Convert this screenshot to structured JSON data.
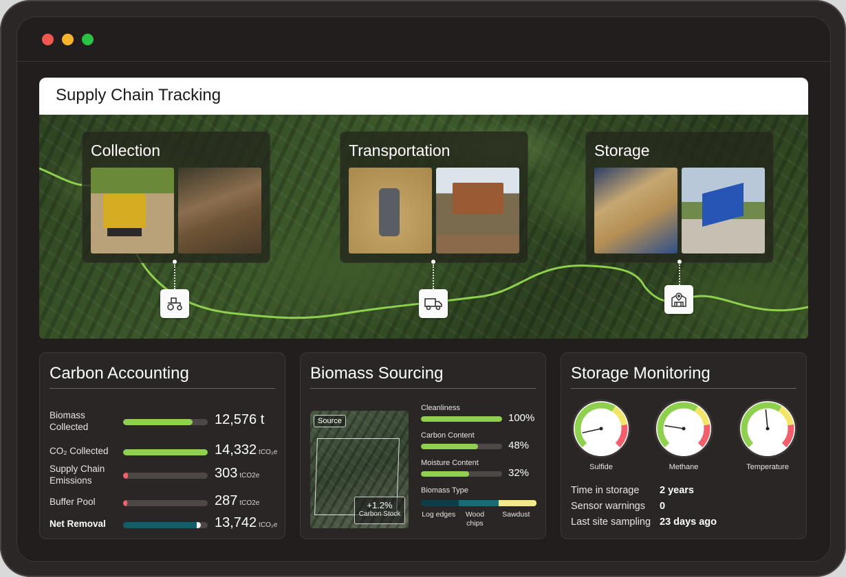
{
  "window": {
    "controls": [
      "close",
      "minimize",
      "maximize"
    ]
  },
  "supply_chain": {
    "title": "Supply Chain Tracking",
    "stages": [
      {
        "title": "Collection",
        "icon": "tractor-icon",
        "photos": [
          "wheel-loader-photo",
          "wood-logs-photo"
        ]
      },
      {
        "title": "Transportation",
        "icon": "truck-icon",
        "photos": [
          "moisture-meter-photo",
          "dump-truck-photo"
        ]
      },
      {
        "title": "Storage",
        "icon": "warehouse-location-icon",
        "photos": [
          "auger-conveyor-photo",
          "dump-trailer-photo"
        ]
      }
    ]
  },
  "carbon_accounting": {
    "title": "Carbon Accounting",
    "rows": [
      {
        "label": "Biomass Collected",
        "value": "12,576 t",
        "unit": "",
        "fill": 0.82,
        "color": "#8fd14f"
      },
      {
        "label": "CO₂ Collected",
        "value": "14,332",
        "unit": "tCO₂e",
        "fill": 1.0,
        "color": "#8fd14f"
      },
      {
        "label": "Supply Chain Emissions",
        "value": "303",
        "unit": "tCO2e",
        "fill": 0.06,
        "color": "#f25f6c"
      },
      {
        "label": "Buffer Pool",
        "value": "287",
        "unit": "tCO2e",
        "fill": 0.05,
        "color": "#f25f6c"
      },
      {
        "label": "Net Removal",
        "value": "13,742",
        "unit": "tCO₂e",
        "fill": 0.92,
        "color": "#145e6a",
        "bold": true
      }
    ]
  },
  "biomass_sourcing": {
    "title": "Biomass Sourcing",
    "source_tag": "Source",
    "carbon_stock_change": "+1.2%",
    "carbon_stock_label": "Carbon Stock",
    "qualities": [
      {
        "label": "Cleanliness",
        "value": "100%",
        "fill": 1.0
      },
      {
        "label": "Carbon Content",
        "value": "48%",
        "fill": 0.7
      },
      {
        "label": "Moisture Content",
        "value": "32%",
        "fill": 0.59
      }
    ],
    "biomass_type_label": "Biomass Type",
    "biomass_types": [
      {
        "label": "Log edges",
        "share": 0.33,
        "color": "#0f3d47"
      },
      {
        "label": "Wood chips",
        "share": 0.34,
        "color": "#1a6b78"
      },
      {
        "label": "Sawdust",
        "share": 0.33,
        "color": "#f3e98c"
      }
    ]
  },
  "storage_monitoring": {
    "title": "Storage Monitoring",
    "gauges": [
      {
        "label": "Sulfide",
        "level": 0.12
      },
      {
        "label": "Methane",
        "level": 0.2
      },
      {
        "label": "Temperature",
        "level": 0.48
      }
    ],
    "stats": [
      {
        "label": "Time in storage",
        "value": "2 years"
      },
      {
        "label": "Sensor warnings",
        "value": "0"
      },
      {
        "label": "Last site sampling",
        "value": "23 days ago"
      }
    ]
  }
}
